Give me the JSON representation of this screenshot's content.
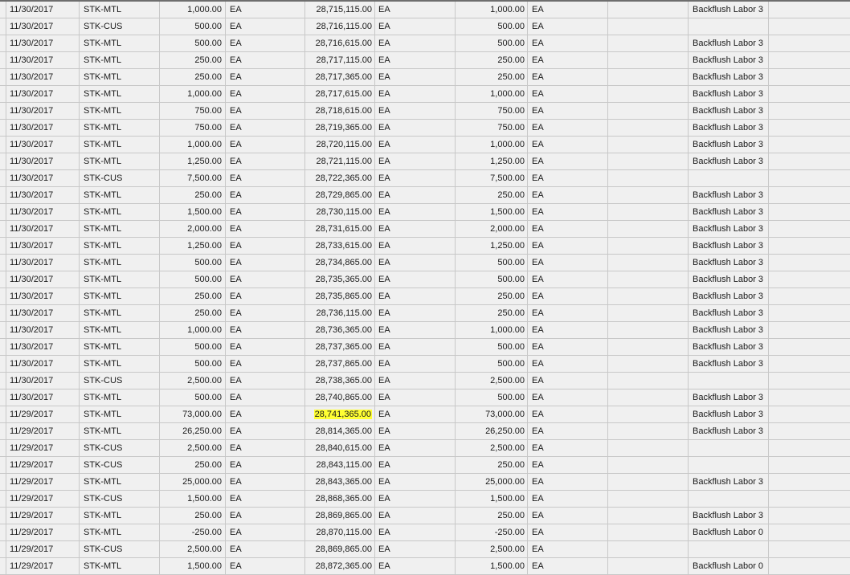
{
  "rows": [
    {
      "date": "11/30/2017",
      "type": "STK-MTL",
      "qty": "1,000.00",
      "uom1": "EA",
      "running": "28,715,115.00",
      "uom2": "EA",
      "qty2": "1,000.00",
      "uom3": "EA",
      "desc": "Backflush Labor 3"
    },
    {
      "date": "11/30/2017",
      "type": "STK-CUS",
      "qty": "500.00",
      "uom1": "EA",
      "running": "28,716,115.00",
      "uom2": "EA",
      "qty2": "500.00",
      "uom3": "EA",
      "desc": ""
    },
    {
      "date": "11/30/2017",
      "type": "STK-MTL",
      "qty": "500.00",
      "uom1": "EA",
      "running": "28,716,615.00",
      "uom2": "EA",
      "qty2": "500.00",
      "uom3": "EA",
      "desc": "Backflush Labor 3"
    },
    {
      "date": "11/30/2017",
      "type": "STK-MTL",
      "qty": "250.00",
      "uom1": "EA",
      "running": "28,717,115.00",
      "uom2": "EA",
      "qty2": "250.00",
      "uom3": "EA",
      "desc": "Backflush Labor 3"
    },
    {
      "date": "11/30/2017",
      "type": "STK-MTL",
      "qty": "250.00",
      "uom1": "EA",
      "running": "28,717,365.00",
      "uom2": "EA",
      "qty2": "250.00",
      "uom3": "EA",
      "desc": "Backflush Labor 3"
    },
    {
      "date": "11/30/2017",
      "type": "STK-MTL",
      "qty": "1,000.00",
      "uom1": "EA",
      "running": "28,717,615.00",
      "uom2": "EA",
      "qty2": "1,000.00",
      "uom3": "EA",
      "desc": "Backflush Labor 3"
    },
    {
      "date": "11/30/2017",
      "type": "STK-MTL",
      "qty": "750.00",
      "uom1": "EA",
      "running": "28,718,615.00",
      "uom2": "EA",
      "qty2": "750.00",
      "uom3": "EA",
      "desc": "Backflush Labor 3"
    },
    {
      "date": "11/30/2017",
      "type": "STK-MTL",
      "qty": "750.00",
      "uom1": "EA",
      "running": "28,719,365.00",
      "uom2": "EA",
      "qty2": "750.00",
      "uom3": "EA",
      "desc": "Backflush Labor 3"
    },
    {
      "date": "11/30/2017",
      "type": "STK-MTL",
      "qty": "1,000.00",
      "uom1": "EA",
      "running": "28,720,115.00",
      "uom2": "EA",
      "qty2": "1,000.00",
      "uom3": "EA",
      "desc": "Backflush Labor 3"
    },
    {
      "date": "11/30/2017",
      "type": "STK-MTL",
      "qty": "1,250.00",
      "uom1": "EA",
      "running": "28,721,115.00",
      "uom2": "EA",
      "qty2": "1,250.00",
      "uom3": "EA",
      "desc": "Backflush Labor 3"
    },
    {
      "date": "11/30/2017",
      "type": "STK-CUS",
      "qty": "7,500.00",
      "uom1": "EA",
      "running": "28,722,365.00",
      "uom2": "EA",
      "qty2": "7,500.00",
      "uom3": "EA",
      "desc": ""
    },
    {
      "date": "11/30/2017",
      "type": "STK-MTL",
      "qty": "250.00",
      "uom1": "EA",
      "running": "28,729,865.00",
      "uom2": "EA",
      "qty2": "250.00",
      "uom3": "EA",
      "desc": "Backflush Labor 3"
    },
    {
      "date": "11/30/2017",
      "type": "STK-MTL",
      "qty": "1,500.00",
      "uom1": "EA",
      "running": "28,730,115.00",
      "uom2": "EA",
      "qty2": "1,500.00",
      "uom3": "EA",
      "desc": "Backflush Labor 3"
    },
    {
      "date": "11/30/2017",
      "type": "STK-MTL",
      "qty": "2,000.00",
      "uom1": "EA",
      "running": "28,731,615.00",
      "uom2": "EA",
      "qty2": "2,000.00",
      "uom3": "EA",
      "desc": "Backflush Labor 3"
    },
    {
      "date": "11/30/2017",
      "type": "STK-MTL",
      "qty": "1,250.00",
      "uom1": "EA",
      "running": "28,733,615.00",
      "uom2": "EA",
      "qty2": "1,250.00",
      "uom3": "EA",
      "desc": "Backflush Labor 3"
    },
    {
      "date": "11/30/2017",
      "type": "STK-MTL",
      "qty": "500.00",
      "uom1": "EA",
      "running": "28,734,865.00",
      "uom2": "EA",
      "qty2": "500.00",
      "uom3": "EA",
      "desc": "Backflush Labor 3"
    },
    {
      "date": "11/30/2017",
      "type": "STK-MTL",
      "qty": "500.00",
      "uom1": "EA",
      "running": "28,735,365.00",
      "uom2": "EA",
      "qty2": "500.00",
      "uom3": "EA",
      "desc": "Backflush Labor 3"
    },
    {
      "date": "11/30/2017",
      "type": "STK-MTL",
      "qty": "250.00",
      "uom1": "EA",
      "running": "28,735,865.00",
      "uom2": "EA",
      "qty2": "250.00",
      "uom3": "EA",
      "desc": "Backflush Labor 3"
    },
    {
      "date": "11/30/2017",
      "type": "STK-MTL",
      "qty": "250.00",
      "uom1": "EA",
      "running": "28,736,115.00",
      "uom2": "EA",
      "qty2": "250.00",
      "uom3": "EA",
      "desc": "Backflush Labor 3"
    },
    {
      "date": "11/30/2017",
      "type": "STK-MTL",
      "qty": "1,000.00",
      "uom1": "EA",
      "running": "28,736,365.00",
      "uom2": "EA",
      "qty2": "1,000.00",
      "uom3": "EA",
      "desc": "Backflush Labor 3"
    },
    {
      "date": "11/30/2017",
      "type": "STK-MTL",
      "qty": "500.00",
      "uom1": "EA",
      "running": "28,737,365.00",
      "uom2": "EA",
      "qty2": "500.00",
      "uom3": "EA",
      "desc": "Backflush Labor 3"
    },
    {
      "date": "11/30/2017",
      "type": "STK-MTL",
      "qty": "500.00",
      "uom1": "EA",
      "running": "28,737,865.00",
      "uom2": "EA",
      "qty2": "500.00",
      "uom3": "EA",
      "desc": "Backflush Labor 3"
    },
    {
      "date": "11/30/2017",
      "type": "STK-CUS",
      "qty": "2,500.00",
      "uom1": "EA",
      "running": "28,738,365.00",
      "uom2": "EA",
      "qty2": "2,500.00",
      "uom3": "EA",
      "desc": ""
    },
    {
      "date": "11/30/2017",
      "type": "STK-MTL",
      "qty": "500.00",
      "uom1": "EA",
      "running": "28,740,865.00",
      "uom2": "EA",
      "qty2": "500.00",
      "uom3": "EA",
      "desc": "Backflush Labor 3"
    },
    {
      "date": "11/29/2017",
      "type": "STK-MTL",
      "qty": "73,000.00",
      "uom1": "EA",
      "running": "28,741,365.00",
      "uom2": "EA",
      "qty2": "73,000.00",
      "uom3": "EA",
      "desc": "Backflush Labor 3",
      "highlight": true
    },
    {
      "date": "11/29/2017",
      "type": "STK-MTL",
      "qty": "26,250.00",
      "uom1": "EA",
      "running": "28,814,365.00",
      "uom2": "EA",
      "qty2": "26,250.00",
      "uom3": "EA",
      "desc": "Backflush Labor 3"
    },
    {
      "date": "11/29/2017",
      "type": "STK-CUS",
      "qty": "2,500.00",
      "uom1": "EA",
      "running": "28,840,615.00",
      "uom2": "EA",
      "qty2": "2,500.00",
      "uom3": "EA",
      "desc": ""
    },
    {
      "date": "11/29/2017",
      "type": "STK-CUS",
      "qty": "250.00",
      "uom1": "EA",
      "running": "28,843,115.00",
      "uom2": "EA",
      "qty2": "250.00",
      "uom3": "EA",
      "desc": ""
    },
    {
      "date": "11/29/2017",
      "type": "STK-MTL",
      "qty": "25,000.00",
      "uom1": "EA",
      "running": "28,843,365.00",
      "uom2": "EA",
      "qty2": "25,000.00",
      "uom3": "EA",
      "desc": "Backflush Labor 3"
    },
    {
      "date": "11/29/2017",
      "type": "STK-CUS",
      "qty": "1,500.00",
      "uom1": "EA",
      "running": "28,868,365.00",
      "uom2": "EA",
      "qty2": "1,500.00",
      "uom3": "EA",
      "desc": ""
    },
    {
      "date": "11/29/2017",
      "type": "STK-MTL",
      "qty": "250.00",
      "uom1": "EA",
      "running": "28,869,865.00",
      "uom2": "EA",
      "qty2": "250.00",
      "uom3": "EA",
      "desc": "Backflush Labor 3"
    },
    {
      "date": "11/29/2017",
      "type": "STK-MTL",
      "qty": "-250.00",
      "uom1": "EA",
      "running": "28,870,115.00",
      "uom2": "EA",
      "qty2": "-250.00",
      "uom3": "EA",
      "desc": "Backflush Labor 0"
    },
    {
      "date": "11/29/2017",
      "type": "STK-CUS",
      "qty": "2,500.00",
      "uom1": "EA",
      "running": "28,869,865.00",
      "uom2": "EA",
      "qty2": "2,500.00",
      "uom3": "EA",
      "desc": ""
    },
    {
      "date": "11/29/2017",
      "type": "STK-MTL",
      "qty": "1,500.00",
      "uom1": "EA",
      "running": "28,872,365.00",
      "uom2": "EA",
      "qty2": "1,500.00",
      "uom3": "EA",
      "desc": "Backflush Labor 0"
    }
  ],
  "colors": {
    "highlight": "#ffff33",
    "grid_line": "#c8c8c8",
    "background": "#f0f0f0"
  }
}
